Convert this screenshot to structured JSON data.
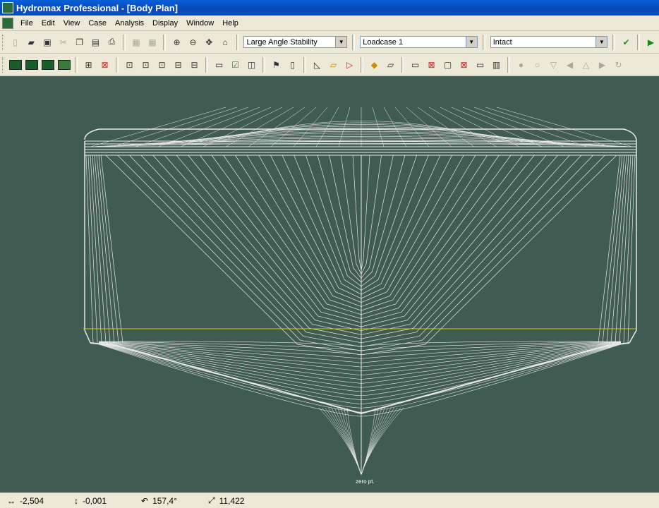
{
  "window": {
    "title": "Hydromax Professional - [Body Plan]"
  },
  "menu": [
    "File",
    "Edit",
    "View",
    "Case",
    "Analysis",
    "Display",
    "Window",
    "Help"
  ],
  "toolbar1": {
    "analysis_type": "Large Angle Stability",
    "loadcase": "Loadcase 1",
    "damage_case": "Intact"
  },
  "canvas": {
    "zero_label": "zero pt.",
    "background": "#3f5b52",
    "line_color": "#e8e8e8",
    "waterline_color": "#d4c800"
  },
  "status": {
    "x_value": "-2,504",
    "y_value": "-0,001",
    "angle_value": "157,4°",
    "zoom_value": "11,422"
  }
}
